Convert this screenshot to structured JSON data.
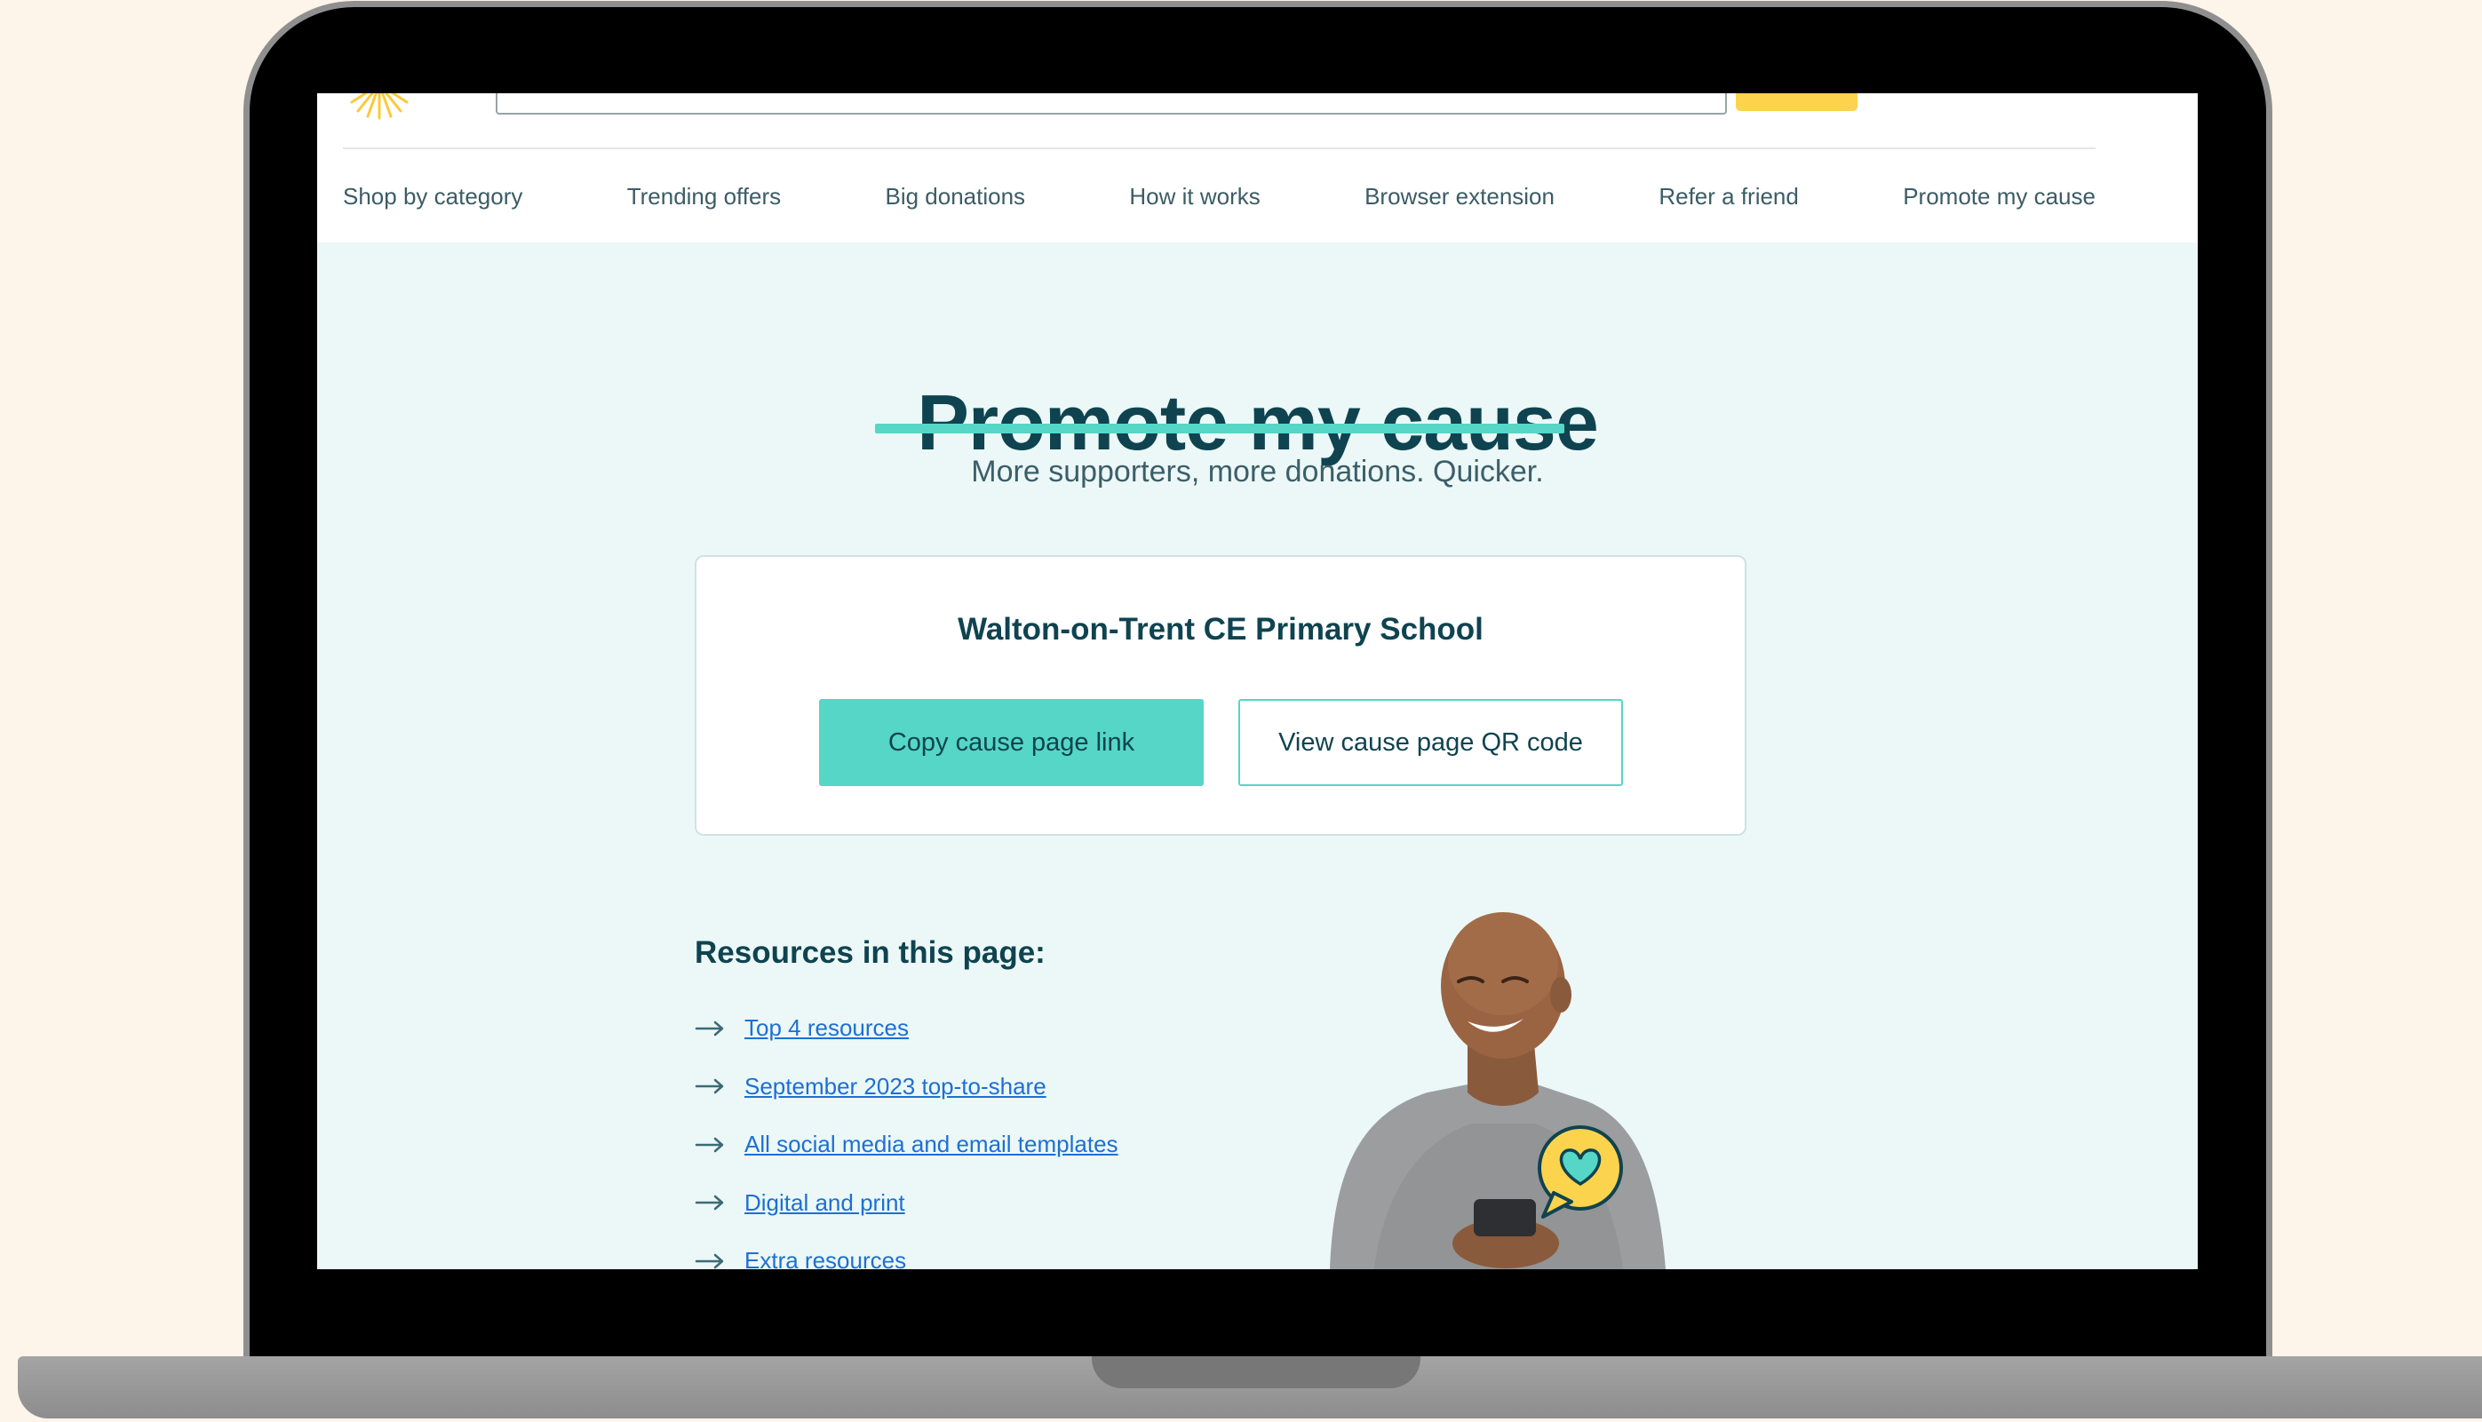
{
  "nav": {
    "items": [
      "Shop by category",
      "Trending offers",
      "Big donations",
      "How it works",
      "Browser extension",
      "Refer a friend",
      "Promote my cause"
    ]
  },
  "hero": {
    "title": "Promote my cause",
    "subtitle": "More supporters, more donations. Quicker."
  },
  "cause": {
    "name": "Walton-on-Trent CE Primary School",
    "copy_button": "Copy cause page link",
    "qr_button": "View cause page QR code"
  },
  "resources": {
    "heading": "Resources in this page:",
    "links": [
      "Top 4 resources",
      "September 2023 top-to-share",
      "All social media and email templates",
      "Digital and print",
      "Extra resources"
    ]
  },
  "colors": {
    "accent": "#56d6c6",
    "heading": "#0f4350",
    "link": "#1e6fd4",
    "page_background": "#ebf8f7",
    "brand_yellow": "#fcd34d"
  }
}
